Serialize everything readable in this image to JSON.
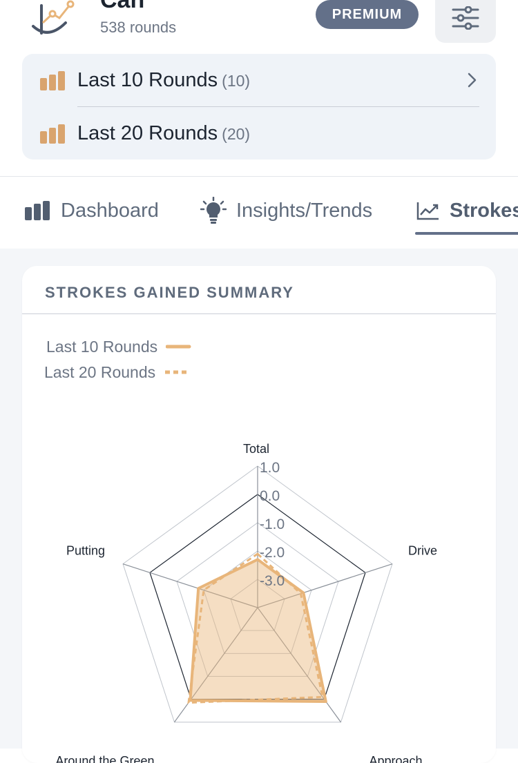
{
  "header": {
    "user_name": "Can",
    "rounds_count": "538 rounds",
    "badge": "PREMIUM"
  },
  "round_filters": [
    {
      "label": "Last 10 Rounds",
      "count": "(10)"
    },
    {
      "label": "Last 20 Rounds",
      "count": "(20)"
    }
  ],
  "tabs": [
    {
      "label": "Dashboard",
      "icon": "bar-chart-icon"
    },
    {
      "label": "Insights/Trends",
      "icon": "lightbulb-icon"
    },
    {
      "label": "Strokes",
      "icon": "trend-line-icon",
      "active": true
    }
  ],
  "card": {
    "title": "STROKES GAINED SUMMARY",
    "legend": [
      {
        "label": "Last 10 Rounds",
        "style": "solid"
      },
      {
        "label": "Last 20 Rounds",
        "style": "dashed"
      }
    ]
  },
  "colors": {
    "accent": "#e8b57a",
    "bar_icon": "#d9a46e",
    "badge": "#637089",
    "fill": "#f3d8b6"
  },
  "chart_data": {
    "type": "radar",
    "axes": [
      "Total",
      "Drive",
      "Approach",
      "Around the Green",
      "Putting"
    ],
    "ticks": [
      "1.0",
      "0.0",
      "-1.0",
      "-2.0",
      "-3.0"
    ],
    "range": [
      -4,
      1
    ],
    "series": [
      {
        "name": "Last 10 Rounds",
        "values": [
          -2.3,
          -2.3,
          0.1,
          0.05,
          -1.8
        ]
      },
      {
        "name": "Last 20 Rounds",
        "values": [
          -2.1,
          -2.4,
          -0.1,
          0.15,
          -2.0
        ]
      }
    ]
  }
}
